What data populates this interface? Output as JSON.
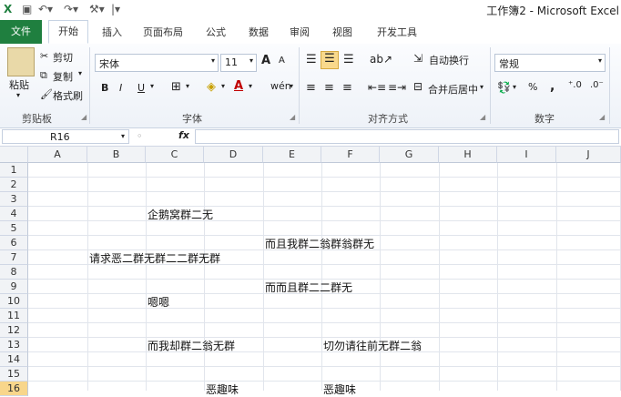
{
  "window": {
    "title": "工作簿2 - Microsoft Excel"
  },
  "tabs": [
    "文件",
    "开始",
    "插入",
    "页面布局",
    "公式",
    "数据",
    "审阅",
    "视图",
    "开发工具"
  ],
  "clipboard": {
    "paste": "粘贴",
    "cut": "剪切",
    "copy": "复制",
    "format_painter": "格式刷",
    "label": "剪贴板"
  },
  "font": {
    "name": "宋体",
    "size": "11",
    "bold": "B",
    "italic": "I",
    "underline": "U",
    "grow": "A",
    "shrink": "A",
    "phonetic": "wén",
    "label": "字体"
  },
  "alignment": {
    "wrap": "自动换行",
    "merge": "合并后居中",
    "label": "对齐方式"
  },
  "number": {
    "format": "常规",
    "percent": "%",
    "comma": ",",
    "label": "数字"
  },
  "formula_bar": {
    "name_box": "R16",
    "fx": "fx"
  },
  "columns": [
    "A",
    "B",
    "C",
    "D",
    "E",
    "F",
    "G",
    "H",
    "I",
    "J"
  ],
  "rows": [
    "1",
    "2",
    "3",
    "4",
    "5",
    "6",
    "7",
    "8",
    "9",
    "10",
    "11",
    "12",
    "13",
    "14",
    "15",
    "16"
  ],
  "selected_row": "16",
  "cells": [
    {
      "ref": "C4",
      "text": "企鹅窝群二无"
    },
    {
      "ref": "E6",
      "text": "而且我群二翁群翁群无"
    },
    {
      "ref": "B7",
      "text": "请求恶二群无群二二群无群"
    },
    {
      "ref": "E9",
      "text": "而而且群二二群无"
    },
    {
      "ref": "C10",
      "text": "嗯嗯"
    },
    {
      "ref": "C13",
      "text": "而我却群二翁无群"
    },
    {
      "ref": "F13",
      "text": "切勿请往前无群二翁"
    },
    {
      "ref": "D16",
      "text": "恶趣味"
    },
    {
      "ref": "F16",
      "text": "恶趣味"
    }
  ]
}
